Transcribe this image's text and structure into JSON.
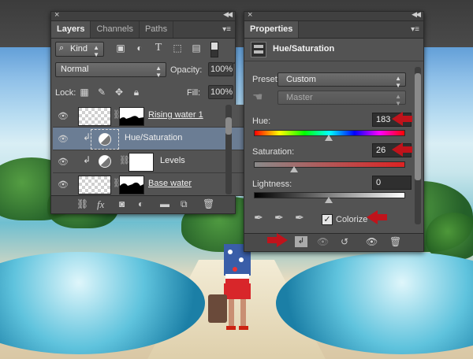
{
  "layers_panel": {
    "tabs": [
      "Layers",
      "Channels",
      "Paths"
    ],
    "filter": {
      "label": "Kind"
    },
    "blend_mode": "Normal",
    "opacity_label": "Opacity:",
    "opacity_value": "100%",
    "lock_label": "Lock:",
    "fill_label": "Fill:",
    "fill_value": "100%",
    "layers": [
      {
        "name": "Rising water 1",
        "selected": false
      },
      {
        "name": "Hue/Saturation",
        "selected": true
      },
      {
        "name": "Levels",
        "selected": false
      },
      {
        "name": "Base water",
        "selected": false
      }
    ],
    "footer_icons": [
      "link-icon",
      "fx-icon",
      "mask-icon",
      "adjustment-icon",
      "folder-icon",
      "new-layer-icon",
      "trash-icon"
    ],
    "footer_fx_label": "fx"
  },
  "properties_panel": {
    "tab": "Properties",
    "title": "Hue/Saturation",
    "preset_label": "Preset:",
    "preset_value": "Custom",
    "channel_value": "Master",
    "hue_label": "Hue:",
    "hue_value": "183",
    "saturation_label": "Saturation:",
    "saturation_value": "26",
    "lightness_label": "Lightness:",
    "lightness_value": "0",
    "colorize_label": "Colorize",
    "colorize_checked": true,
    "accent_color": "#c0131b"
  }
}
